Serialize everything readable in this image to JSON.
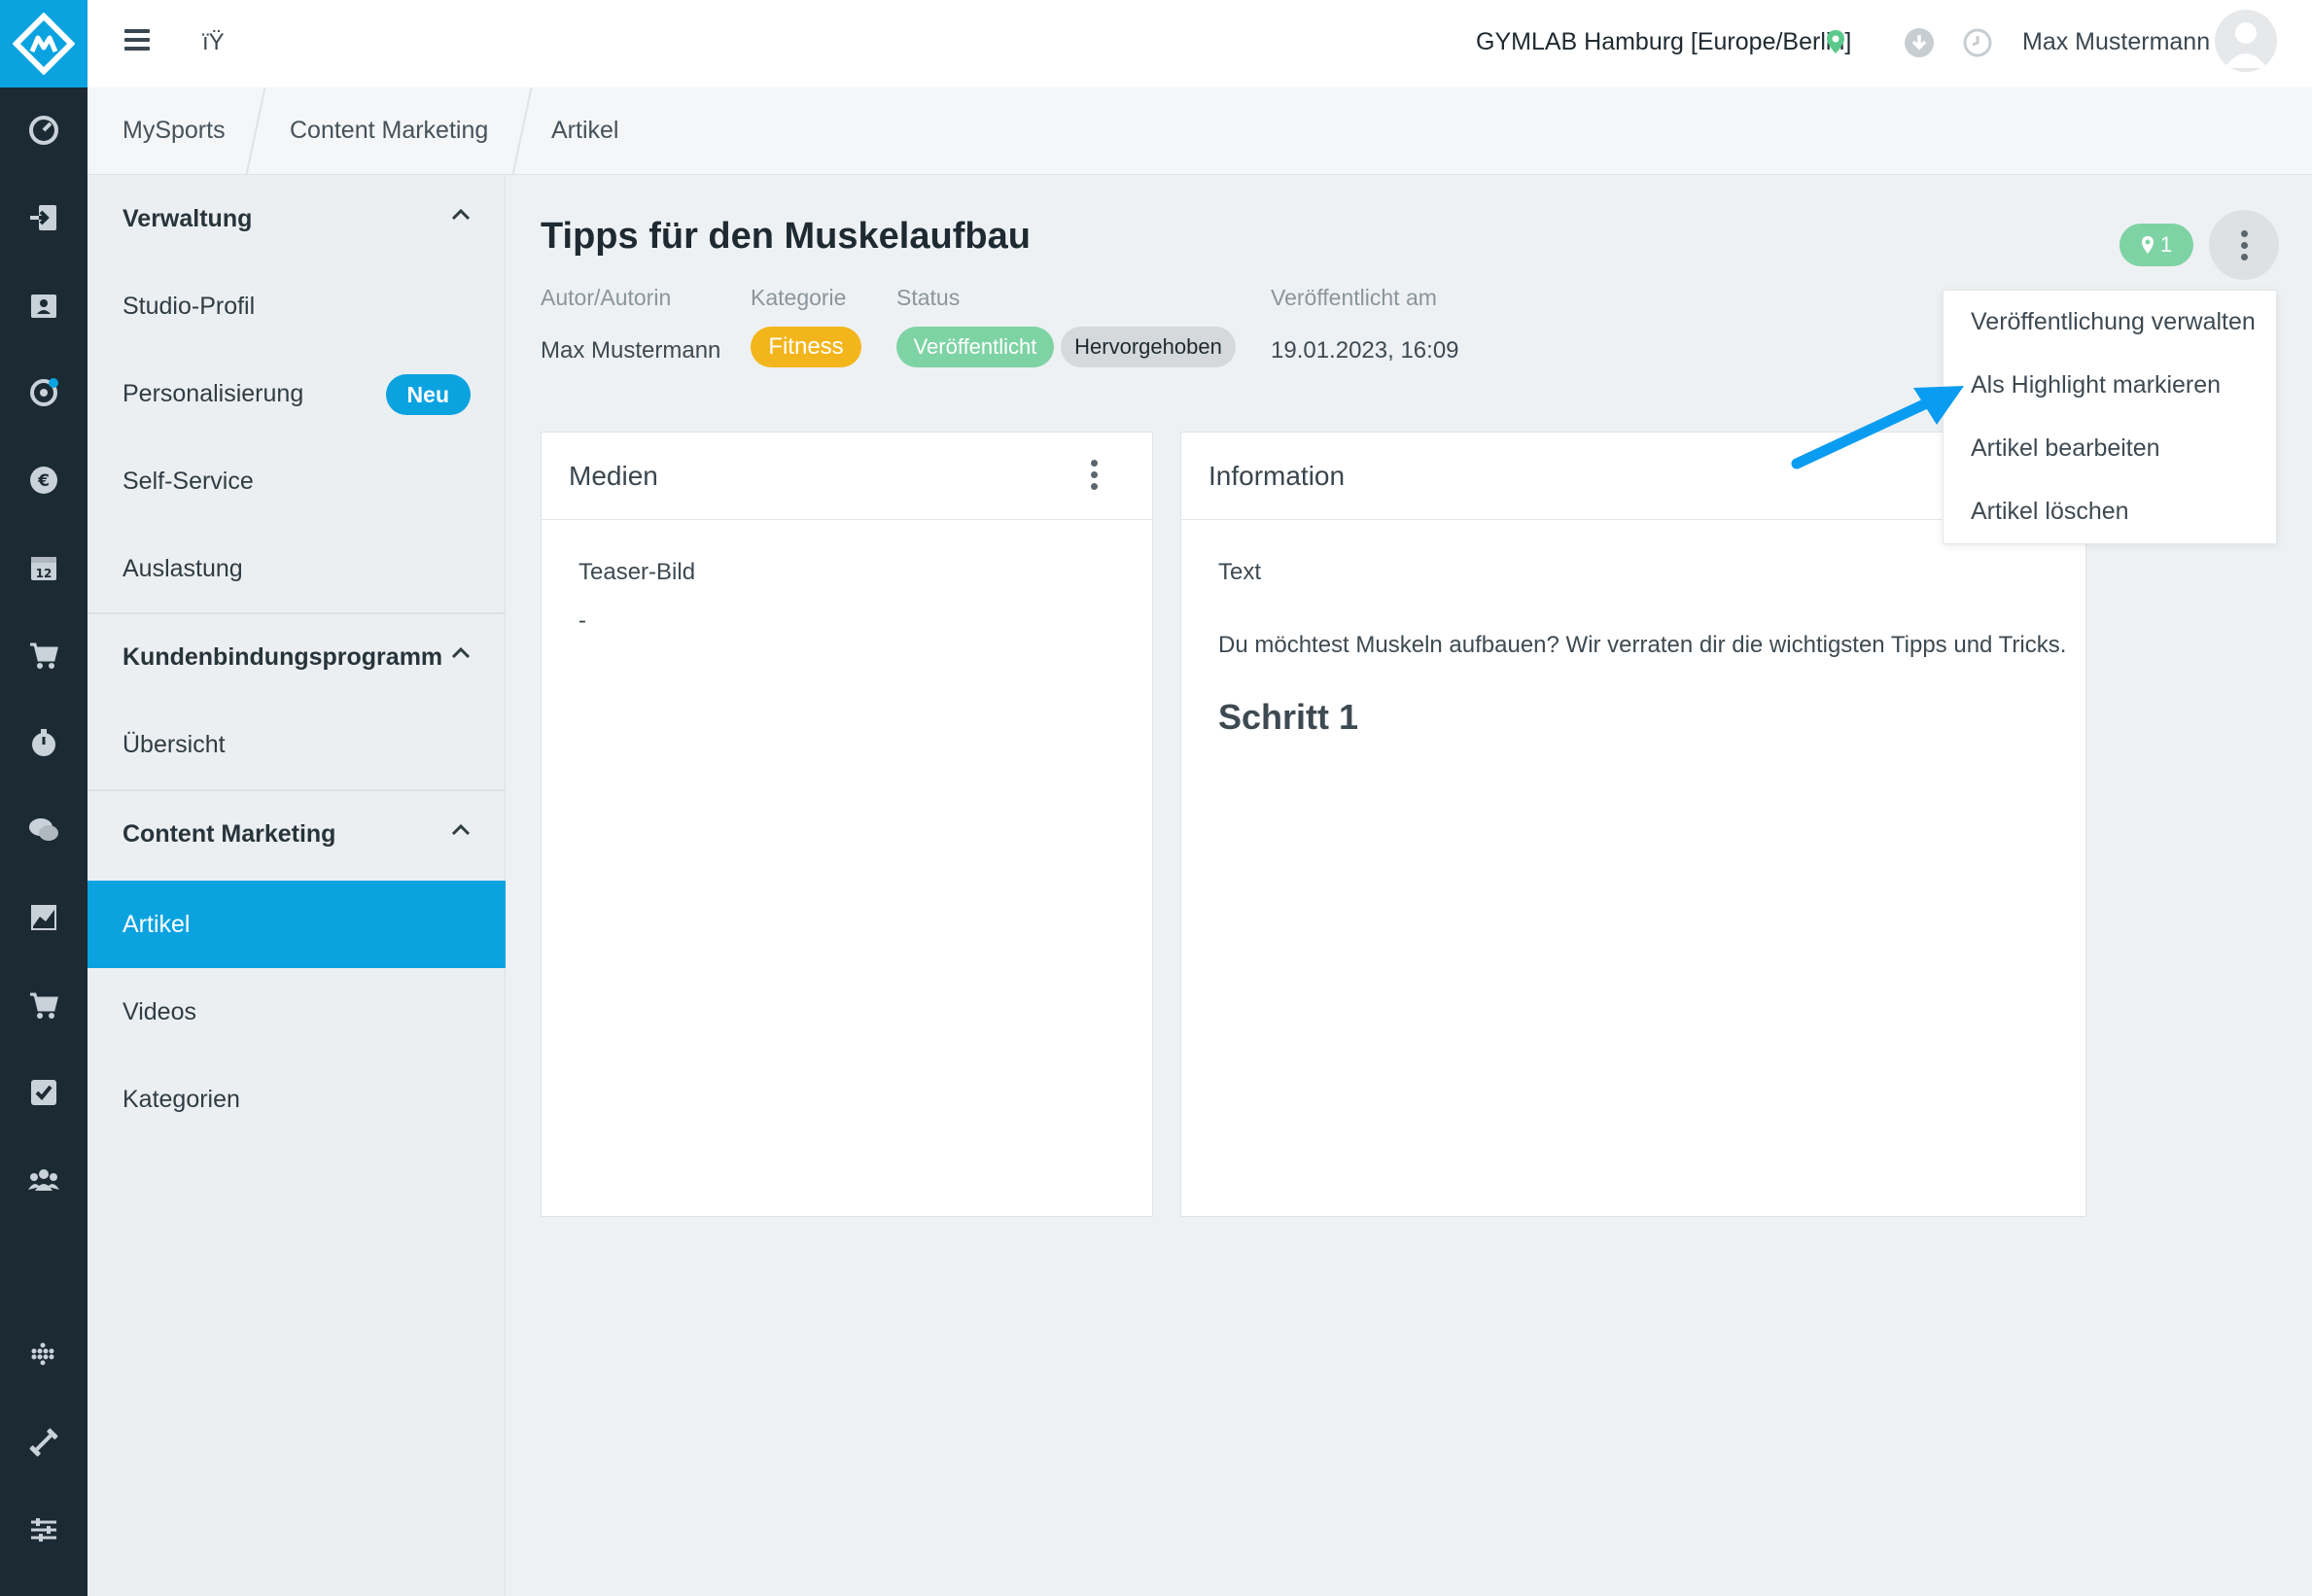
{
  "topbar": {
    "lang_glyph": "ïŸ",
    "location": "GYMLAB Hamburg [Europe/Berlin]",
    "user_name": "Max Mustermann"
  },
  "breadcrumb": [
    "MySports",
    "Content Marketing",
    "Artikel"
  ],
  "sidebar": {
    "sections": [
      {
        "label": "Verwaltung",
        "items": [
          "Studio-Profil",
          "Personalisierung",
          "Self-Service",
          "Auslastung"
        ]
      },
      {
        "label": "Kundenbindungsprogramm",
        "items": [
          "Übersicht"
        ]
      },
      {
        "label": "Content Marketing",
        "items": [
          "Artikel",
          "Videos",
          "Kategorien"
        ]
      }
    ],
    "new_badge": "Neu",
    "active_item": "Artikel"
  },
  "article": {
    "title": "Tipps für den Muskelaufbau",
    "author_label": "Autor/Autorin",
    "author": "Max Mustermann",
    "category_label": "Kategorie",
    "category": "Fitness",
    "status_label": "Status",
    "status_published": "Veröffentlicht",
    "status_featured": "Hervorgehoben",
    "published_label": "Veröffentlicht am",
    "published_at": "19.01.2023, 16:09",
    "location_count": "1"
  },
  "media_card": {
    "title": "Medien",
    "teaser_label": "Teaser-Bild",
    "teaser_value": "-"
  },
  "info_card": {
    "title": "Information",
    "text_label": "Text",
    "text_body": "Du möchtest Muskeln aufbauen? Wir verraten dir die wichtigsten Tipps und Tricks.",
    "heading": "Schritt 1"
  },
  "context_menu": {
    "items": [
      "Veröffentlichung verwalten",
      "Als Highlight markieren",
      "Artikel bearbeiten",
      "Artikel löschen"
    ]
  },
  "colors": {
    "accent": "#0aa3e0",
    "rail": "#1b2a33",
    "green": "#7ed3a4",
    "yellow": "#f3b51c"
  },
  "rail_icons": [
    "dashboard-icon",
    "checkin-icon",
    "contacts-icon",
    "settings-target-icon",
    "euro-icon",
    "calendar-icon",
    "cart-icon",
    "stopwatch-icon",
    "chat-icon",
    "chart-icon",
    "cart-2-icon",
    "checkbox-icon",
    "group-icon",
    "dots-grid-icon",
    "dumbbell-icon",
    "sliders-icon"
  ]
}
